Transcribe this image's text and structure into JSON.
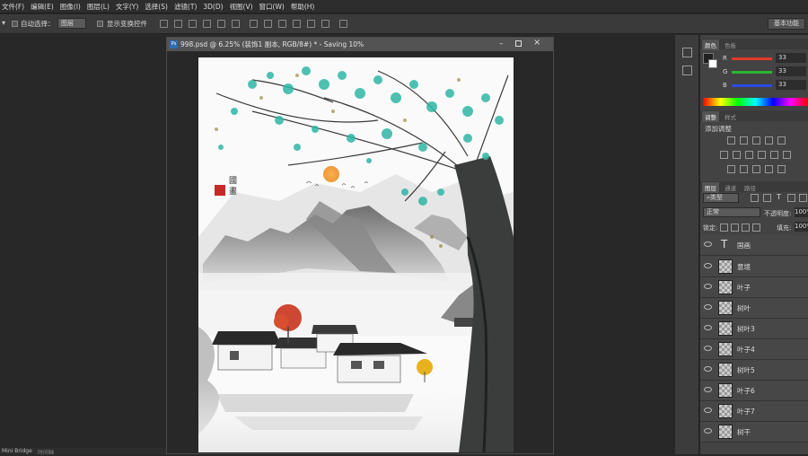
{
  "menu": [
    "文件(F)",
    "编辑(E)",
    "图像(I)",
    "图层(L)",
    "文字(Y)",
    "选择(S)",
    "滤镜(T)",
    "3D(D)",
    "视图(V)",
    "窗口(W)",
    "帮助(H)"
  ],
  "options": {
    "auto_select_label": "自动选择：",
    "auto_select_value": "图层",
    "show_transform_label": "显示变换控件",
    "workspace": "基本功能"
  },
  "document": {
    "tab_title": "998.psd @ 6.25% (装饰1 副本, RGB/8#) * - Saving 10%",
    "ps_badge": "Ps"
  },
  "artwork": {
    "seal_top": "國",
    "seal_bottom": "畫"
  },
  "color_panel": {
    "tabs": [
      "颜色",
      "色板"
    ],
    "channels": [
      {
        "label": "R",
        "value": "33",
        "color": "#e23a2a"
      },
      {
        "label": "G",
        "value": "33",
        "color": "#2cb431"
      },
      {
        "label": "B",
        "value": "33",
        "color": "#2a4be2"
      }
    ]
  },
  "adjust_panel": {
    "tabs": [
      "调整",
      "样式"
    ],
    "title": "添加调整"
  },
  "layers_panel": {
    "tabs": [
      "图层",
      "通道",
      "路径"
    ],
    "filter_kind": "类型",
    "blend_mode": "正常",
    "opacity_label": "不透明度:",
    "opacity_value": "100%",
    "lock_label": "锁定:",
    "fill_label": "填充:",
    "fill_value": "100%",
    "layers": [
      {
        "name": "国画",
        "type": "text"
      },
      {
        "name": "意境",
        "type": "pixel"
      },
      {
        "name": "叶子",
        "type": "pixel"
      },
      {
        "name": "树叶",
        "type": "pixel"
      },
      {
        "name": "树叶3",
        "type": "pixel"
      },
      {
        "name": "叶子4",
        "type": "pixel"
      },
      {
        "name": "树叶5",
        "type": "pixel"
      },
      {
        "name": "叶子6",
        "type": "pixel"
      },
      {
        "name": "叶子7",
        "type": "pixel"
      },
      {
        "name": "树干",
        "type": "pixel"
      }
    ]
  },
  "bottom_tabs": [
    "Mini Bridge",
    "时间轴"
  ],
  "colors": {
    "accent_teal": "#2fb7a6",
    "sun": "#f4a640",
    "maple": "#c9341e",
    "gold_tree": "#e8b21f"
  }
}
